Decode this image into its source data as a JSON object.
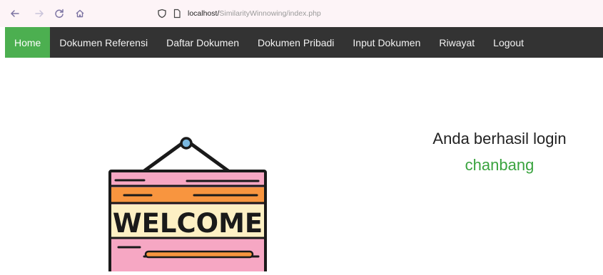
{
  "browser": {
    "url_host": "localhost/",
    "url_path": "SimilarityWinnowing/index.php"
  },
  "nav": {
    "items": [
      {
        "label": "Home",
        "active": true
      },
      {
        "label": "Dokumen Referensi",
        "active": false
      },
      {
        "label": "Daftar Dokumen",
        "active": false
      },
      {
        "label": "Dokumen Pribadi",
        "active": false
      },
      {
        "label": "Input Dokumen",
        "active": false
      },
      {
        "label": "Riwayat",
        "active": false
      },
      {
        "label": "Logout",
        "active": false
      }
    ],
    "active_color": "#4caf50",
    "bar_color": "#333333"
  },
  "main": {
    "login_message": "Anda berhasil login",
    "username": "chanbang",
    "username_color": "#3aa33f",
    "sign_text": "WELCOME"
  }
}
